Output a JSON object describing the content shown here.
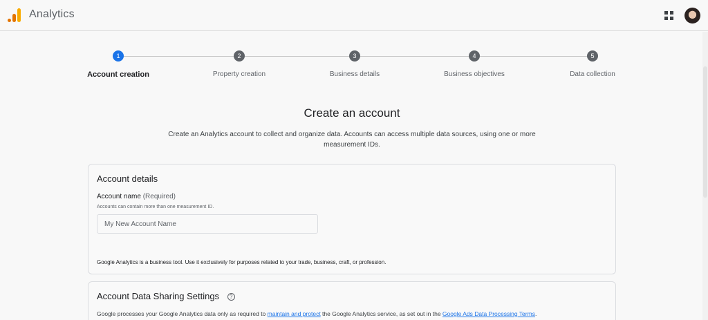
{
  "app": {
    "title": "Analytics"
  },
  "stepper": {
    "steps": [
      {
        "number": "1",
        "label": "Account creation",
        "active": true
      },
      {
        "number": "2",
        "label": "Property creation",
        "active": false
      },
      {
        "number": "3",
        "label": "Business details",
        "active": false
      },
      {
        "number": "4",
        "label": "Business objectives",
        "active": false
      },
      {
        "number": "5",
        "label": "Data collection",
        "active": false
      }
    ]
  },
  "header": {
    "title": "Create an account",
    "subtitle": "Create an Analytics account to collect and organize data. Accounts can access multiple data sources, using one or more measurement IDs."
  },
  "account_details": {
    "title": "Account details",
    "account_name_label": "Account name",
    "required_text": "(Required)",
    "hint": "Accounts can contain more than one measurement ID.",
    "input_placeholder": "My New Account Name",
    "input_value": "",
    "footnote": "Google Analytics is a business tool. Use it exclusively for purposes related to your trade, business, craft, or profession."
  },
  "data_sharing": {
    "title": "Account Data Sharing Settings",
    "help_icon": "?",
    "text_before": "Google processes your Google Analytics data only as required to ",
    "link1": "maintain and protect",
    "text_middle": " the Google Analytics service, as set out in the ",
    "link2": "Google Ads Data Processing Terms",
    "text_after": "."
  },
  "colors": {
    "accent": "#1a73e8",
    "logo_orange": "#e37400",
    "logo_yellow": "#f9ab00",
    "step_inactive": "#5f6368"
  },
  "icons": {
    "logo": "analytics-logo-icon",
    "apps": "apps-grid-icon",
    "help": "help-circle-icon"
  }
}
